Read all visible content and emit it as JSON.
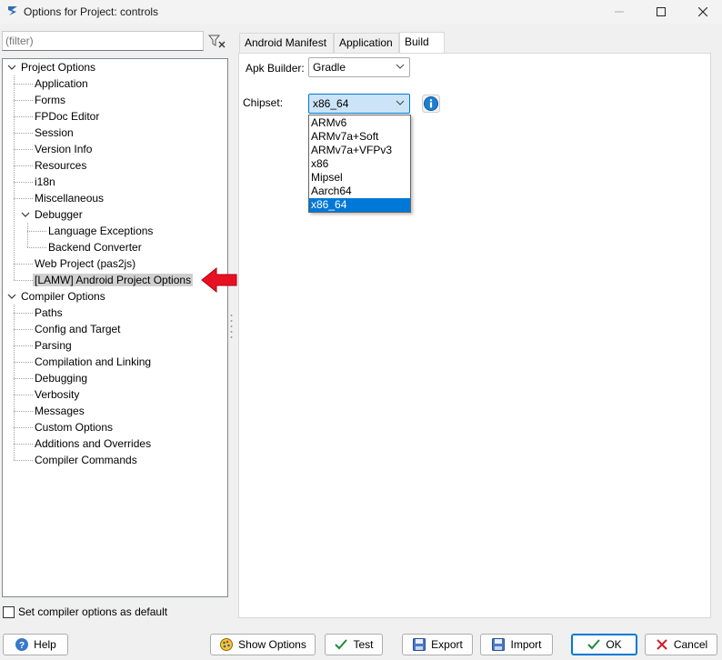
{
  "window": {
    "title": "Options for Project: controls"
  },
  "filter": {
    "placeholder": "(filter)"
  },
  "tree": {
    "items": [
      {
        "label": "Project Options"
      },
      {
        "label": "Application"
      },
      {
        "label": "Forms"
      },
      {
        "label": "FPDoc Editor"
      },
      {
        "label": "Session"
      },
      {
        "label": "Version Info"
      },
      {
        "label": "Resources"
      },
      {
        "label": "i18n"
      },
      {
        "label": "Miscellaneous"
      },
      {
        "label": "Debugger"
      },
      {
        "label": "Language Exceptions"
      },
      {
        "label": "Backend Converter"
      },
      {
        "label": "Web Project (pas2js)"
      },
      {
        "label": "[LAMW] Android Project Options"
      },
      {
        "label": "Compiler Options"
      },
      {
        "label": "Paths"
      },
      {
        "label": "Config and Target"
      },
      {
        "label": "Parsing"
      },
      {
        "label": "Compilation and Linking"
      },
      {
        "label": "Debugging"
      },
      {
        "label": "Verbosity"
      },
      {
        "label": "Messages"
      },
      {
        "label": "Custom Options"
      },
      {
        "label": "Additions and Overrides"
      },
      {
        "label": "Compiler Commands"
      }
    ],
    "selected_index": 13
  },
  "default_checkbox": {
    "label": "Set compiler options as default",
    "checked": false
  },
  "tabs": [
    {
      "label": "Android Manifest"
    },
    {
      "label": "Application"
    },
    {
      "label": "Build",
      "active": true
    }
  ],
  "build": {
    "apk_builder_label": "Apk Builder:",
    "apk_builder_value": "Gradle",
    "chipset_label": "Chipset:",
    "chipset_value": "x86_64",
    "chipset_options": [
      "ARMv6",
      "ARMv7a+Soft",
      "ARMv7a+VFPv3",
      "x86",
      "Mipsel",
      "Aarch64",
      "x86_64"
    ],
    "chipset_selected_index": 6
  },
  "buttons": {
    "help": "Help",
    "show_options": "Show Options",
    "test": "Test",
    "export": "Export",
    "import": "Import",
    "ok": "OK",
    "cancel": "Cancel"
  },
  "colors": {
    "accent": "#0078d7",
    "pointer_arrow": "#e81123",
    "info_icon": "#1e7fd0"
  }
}
